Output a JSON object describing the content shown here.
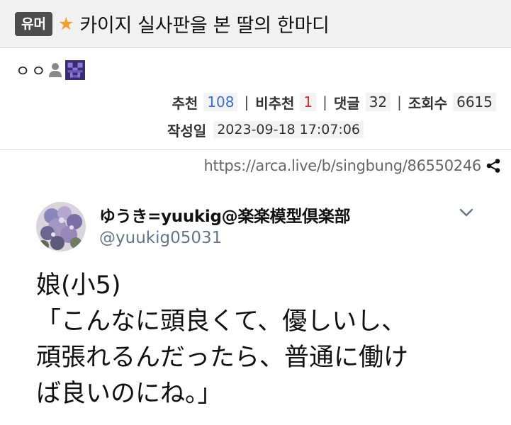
{
  "post": {
    "category_badge": "유머",
    "title": "카이지 실사판을 본 딸의 한마디",
    "author": "ㅇㅇ",
    "stats": {
      "recommend_label": "추천",
      "recommend_value": "108",
      "not_recommend_label": "비추천",
      "not_recommend_value": "1",
      "comments_label": "댓글",
      "comments_value": "32",
      "views_label": "조회수",
      "views_value": "6615"
    },
    "date_label": "작성일",
    "date_value": "2023-09-18 17:07:06",
    "separator": "|",
    "url": "https://arca.live/b/singbung/86550246"
  },
  "tweet": {
    "display_name": "ゆうき=yuukig@楽楽模型倶楽部",
    "handle": "@yuukig05031",
    "lines": [
      "娘(小5)",
      "「こんなに頭良くて、優しいし、",
      "頑張れるんだったら、普通に働け",
      "ば良いのにね。」"
    ]
  },
  "colors": {
    "badge_bg": "#4d4d4d",
    "star": "#f1a02c",
    "recommend": "#3a6fc6",
    "not_recommend": "#d0302b",
    "handle": "#657786"
  },
  "icons": {
    "star": "star-icon",
    "person": "person-icon",
    "avatar": "pixel-avatar-icon",
    "share": "share-icon",
    "chevron": "chevron-down-icon"
  }
}
